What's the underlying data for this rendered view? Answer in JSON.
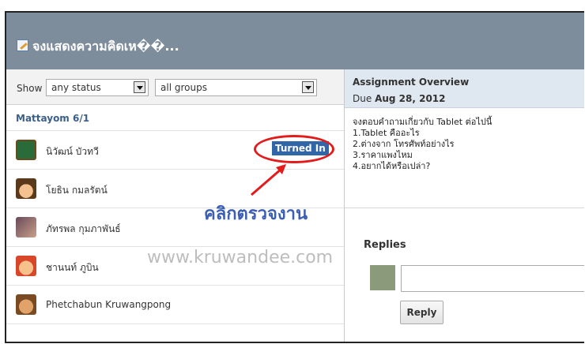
{
  "title": "จงแสดงความคิดเห��...",
  "filters": {
    "show_label": "Show",
    "status_value": "any status",
    "groups_value": "all groups"
  },
  "group_name": "Mattayom 6/1",
  "students": [
    {
      "name": "นิวัฒน์ บัวทวี",
      "status": "Turned In"
    },
    {
      "name": "โยธิน กมลรัตน์",
      "status": ""
    },
    {
      "name": "ภัทรพล กุมภาพันธ์",
      "status": ""
    },
    {
      "name": "ชานนท์ ภูบิน",
      "status": ""
    },
    {
      "name": "Phetchabun Kruwangpong",
      "status": ""
    }
  ],
  "overview": {
    "heading": "Assignment Overview",
    "due_prefix": "Due",
    "due_date": "Aug 28, 2012",
    "lines": [
      "จงตอบคำถามเกี่ยวกับ Tablet ต่อไปนี้",
      "1.Tablet คืออะไร",
      "2.ต่างจาก โทรศัพท์อย่างไร",
      "3.ราคาแพงไหม",
      "4.อยากได้หรือเปล่า?"
    ]
  },
  "replies": {
    "heading": "Replies",
    "button_label": "Reply"
  },
  "annotation": {
    "callout_text": "คลิกตรวจงาน",
    "watermark_text": "www.kruwandee.com",
    "highlight_color": "#e31b1b"
  },
  "icons": {
    "title_icon": "edit-note-icon",
    "dropdown_icon": "chevron-down-icon"
  }
}
